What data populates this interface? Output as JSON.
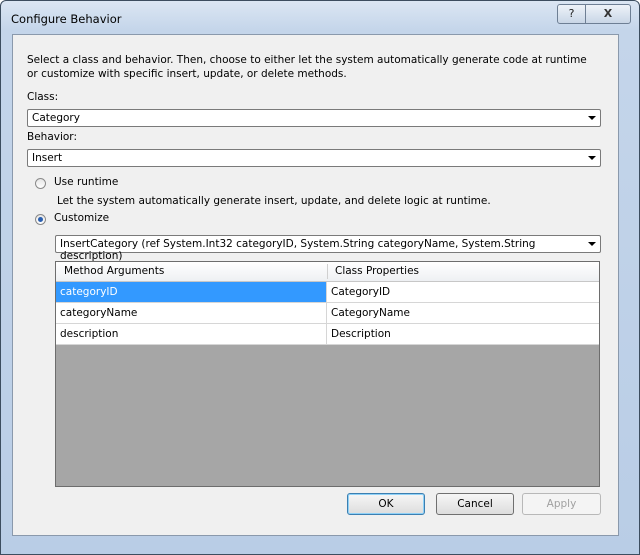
{
  "window": {
    "title": "Configure Behavior",
    "help_label": "?",
    "close_label": "X"
  },
  "description": "Select a class and behavior.  Then, choose to either let the system automatically generate code at runtime or customize with specific insert, update, or delete methods.",
  "class_field": {
    "label": "Class:",
    "value": "Category"
  },
  "behavior_field": {
    "label": "Behavior:",
    "value": "Insert"
  },
  "use_runtime": {
    "label": "Use runtime",
    "selected": false,
    "description": "Let the system automatically generate insert, update, and delete logic at runtime."
  },
  "customize": {
    "label": "Customize",
    "selected": true,
    "method": "InsertCategory (ref System.Int32 categoryID, System.String categoryName, System.String description)"
  },
  "grid": {
    "headers": [
      "Method Arguments",
      "Class Properties"
    ],
    "rows": [
      {
        "argument": "categoryID",
        "property": "CategoryID",
        "selected": true
      },
      {
        "argument": "categoryName",
        "property": "CategoryName",
        "selected": false
      },
      {
        "argument": "description",
        "property": "Description",
        "selected": false
      }
    ]
  },
  "buttons": {
    "ok": "OK",
    "cancel": "Cancel",
    "apply": "Apply"
  }
}
